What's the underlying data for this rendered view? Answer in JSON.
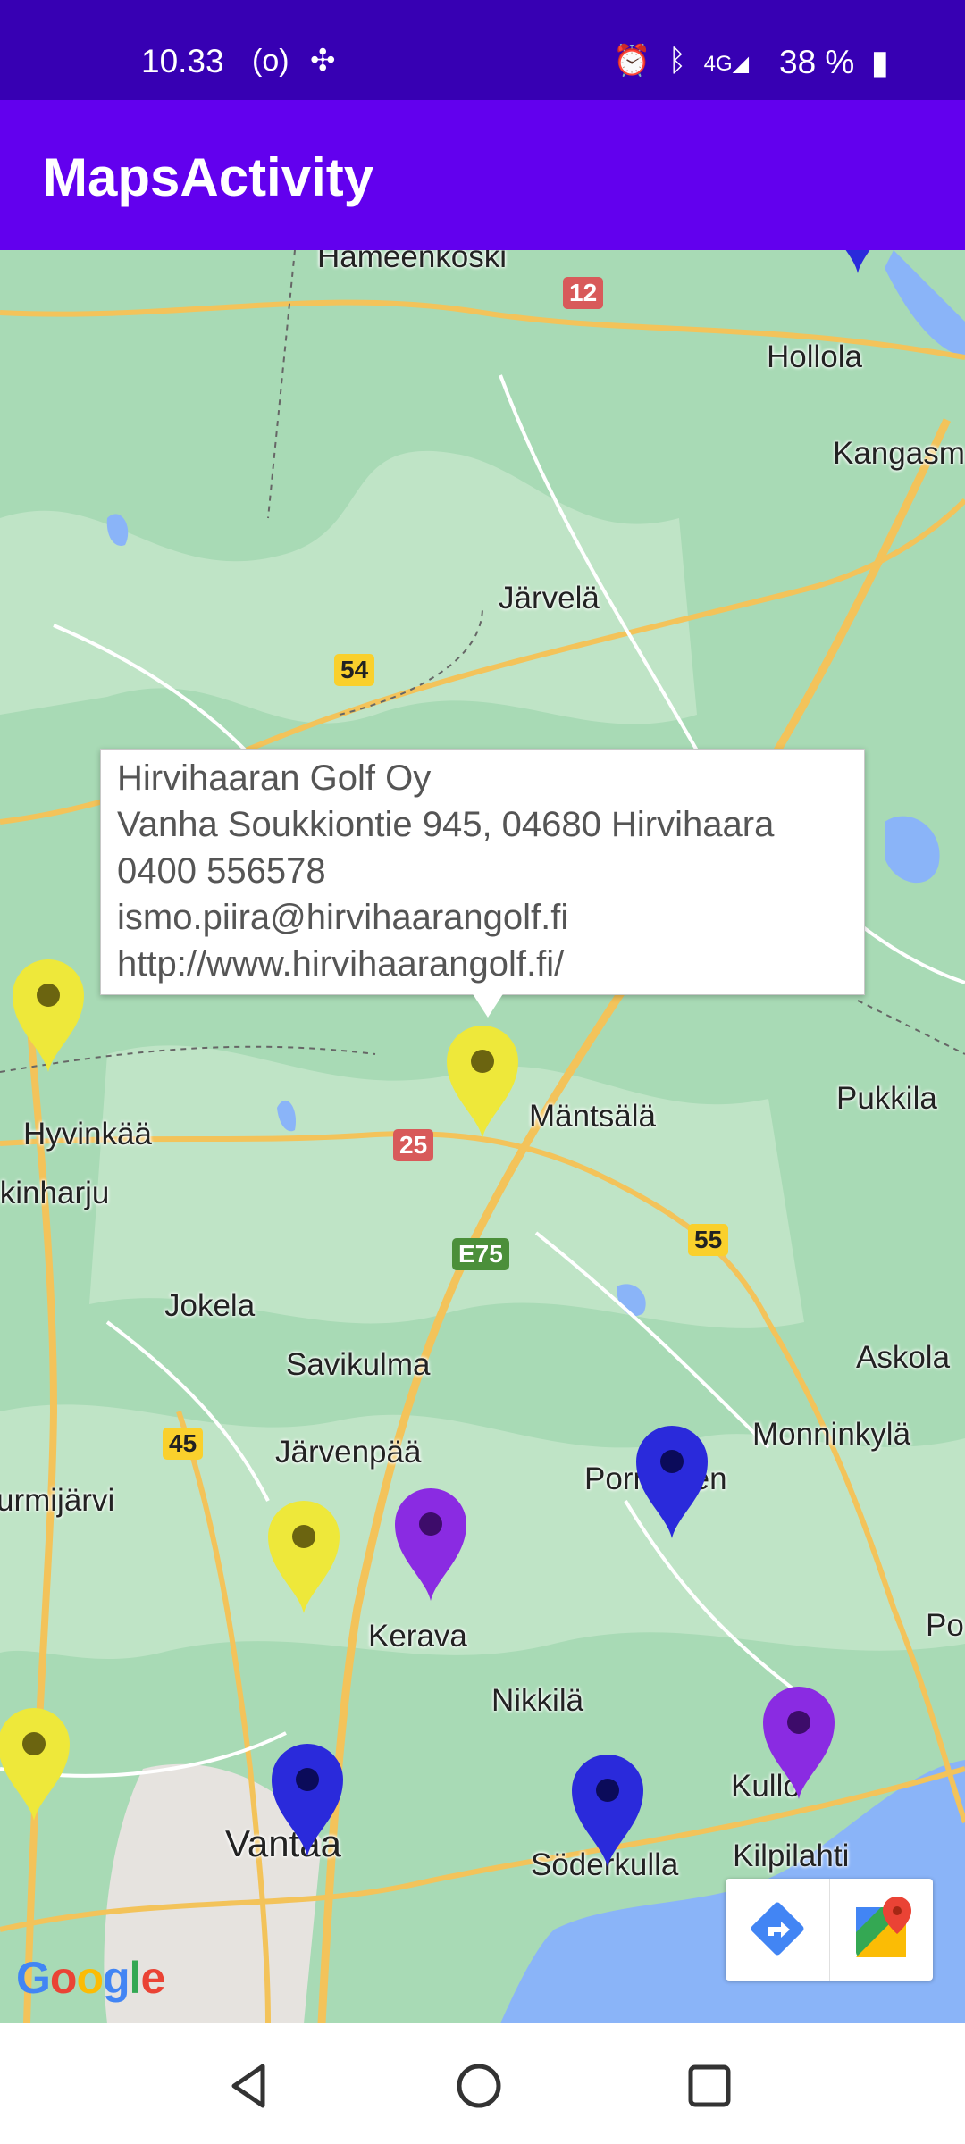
{
  "status_bar": {
    "time": "10.33",
    "left_icons": [
      "radio-icon",
      "pinwheel-icon"
    ],
    "right_icons": [
      "alarm-icon",
      "bluetooth-icon",
      "4g-signal-icon"
    ],
    "battery": "38 %",
    "background": "#3700b3"
  },
  "app_bar": {
    "title": "MapsActivity",
    "background": "#6200ee"
  },
  "map": {
    "places": {
      "hameenkoski": "Hämeenkoski",
      "hollola": "Hollola",
      "kangasm": "Kangasm",
      "jarvela": "Järvelä",
      "hyvinkaa": "Hyvinkää",
      "mantsala": "Mäntsälä",
      "pukkila": "Pukkila",
      "ikinharju": "ikinharju",
      "jokela": "Jokela",
      "savikulma": "Savikulma",
      "askola": "Askola",
      "jarvenpaa": "Järvenpää",
      "monninkyla": "Monninkylä",
      "pornainen": "Pornainen",
      "urmijarvi": "urmijärvi",
      "kerava": "Kerava",
      "po": "Po",
      "nikkila": "Nikkilä",
      "kullo": "Kullo",
      "vantaa": "Vantaa",
      "soderkulla": "Söderkulla",
      "kilpilahti": "Kilpilahti"
    },
    "road_shields": {
      "r12": "12",
      "r54": "54",
      "r25": "25",
      "e75": "E75",
      "r55": "55",
      "r45": "45"
    },
    "markers": [
      {
        "color": "yellow"
      },
      {
        "color": "yellow"
      },
      {
        "color": "yellow"
      },
      {
        "color": "yellow"
      },
      {
        "color": "purple"
      },
      {
        "color": "purple"
      },
      {
        "color": "blue"
      },
      {
        "color": "blue"
      },
      {
        "color": "blue"
      },
      {
        "color": "blue"
      }
    ],
    "marker_colors": {
      "yellow": "#eee83a",
      "purple": "#8a2be2",
      "blue": "#2a2adb"
    },
    "info_window": {
      "name": "Hirvihaaran Golf Oy",
      "address": "Vanha Soukkiontie 945, 04680 Hirvihaara",
      "phone": "0400 556578",
      "email": "ismo.piira@hirvihaarangolf.fi",
      "url": "http://www.hirvihaarangolf.fi/"
    },
    "attribution_logo": "Google",
    "toolbar": [
      "directions-icon",
      "google-maps-icon"
    ]
  },
  "nav_bar": [
    "back-icon",
    "home-icon",
    "recents-icon"
  ]
}
